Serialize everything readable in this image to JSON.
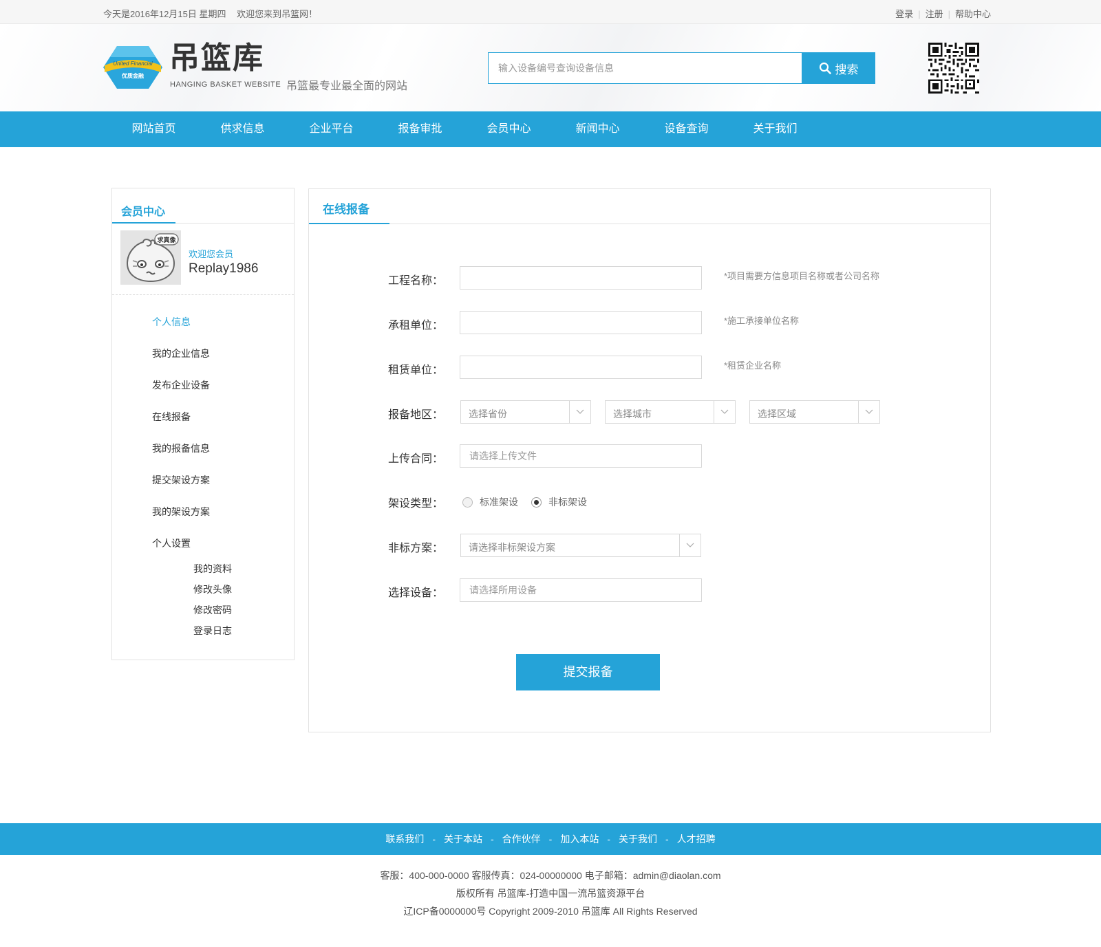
{
  "topbar": {
    "date": "今天是2016年12月15日 星期四",
    "welcome": "欢迎您来到吊篮网！",
    "login": "登录",
    "register": "注册",
    "help": "帮助中心"
  },
  "header": {
    "emblem_text_top": "United Financial",
    "emblem_text_bottom": "优质金融",
    "logo_title": "吊篮库",
    "logo_subtitle": "HANGING BASKET WEBSITE",
    "slogan": "吊篮最专业最全面的网站",
    "search_placeholder": "输入设备编号查询设备信息",
    "search_button": "搜索"
  },
  "nav": {
    "items": [
      "网站首页",
      "供求信息",
      "企业平台",
      "报备审批",
      "会员中心",
      "新闻中心",
      "设备查询",
      "关于我们"
    ]
  },
  "sidebar": {
    "title": "会员中心",
    "avatar_tag": "求真像",
    "welcome": "欢迎您会员",
    "username": "Replay1986",
    "menu": [
      "个人信息",
      "我的企业信息",
      "发布企业设备",
      "在线报备",
      "我的报备信息",
      "提交架设方案",
      "我的架设方案",
      "个人设置"
    ],
    "submenu": [
      "我的资料",
      "修改头像",
      "修改密码",
      "登录日志"
    ]
  },
  "form": {
    "title": "在线报备",
    "project_label": "工程名称：",
    "project_value": "",
    "project_hint": "*项目需要方信息项目名称或者公司名称",
    "contractor_label": "承租单位：",
    "contractor_value": "",
    "contractor_hint": "*施工承接单位名称",
    "lessor_label": "租赁单位：",
    "lessor_value": "",
    "lessor_hint": "*租赁企业名称",
    "region_label": "报备地区：",
    "province": "选择省份",
    "city": "选择城市",
    "district": "选择区域",
    "contract_label": "上传合同：",
    "contract_placeholder": "请选择上传文件",
    "type_label": "架设类型：",
    "type_standard": "标准架设",
    "type_nonstandard": "非标架设",
    "type_selected": "非标架设",
    "plan_label": "非标方案：",
    "plan_placeholder": "请选择非标架设方案",
    "device_label": "选择设备：",
    "device_placeholder": "请选择所用设备",
    "submit": "提交报备"
  },
  "footer": {
    "links": [
      "联系我们",
      "关于本站",
      "合作伙伴",
      "加入本站",
      "关于我们",
      "人才招聘"
    ],
    "contact": "客服：400-000-0000 客服传真：024-00000000 电子邮箱：admin@diaolan.com",
    "rights": "版权所有 吊篮库-打造中国一流吊篮资源平台",
    "icp": "辽ICP备0000000号 Copyright 2009-2010 吊篮库 All Rights Reserved"
  },
  "colors": {
    "accent": "#25a3d8",
    "topbar_bg": "#f6f6f6",
    "border": "#e2e2e2"
  }
}
